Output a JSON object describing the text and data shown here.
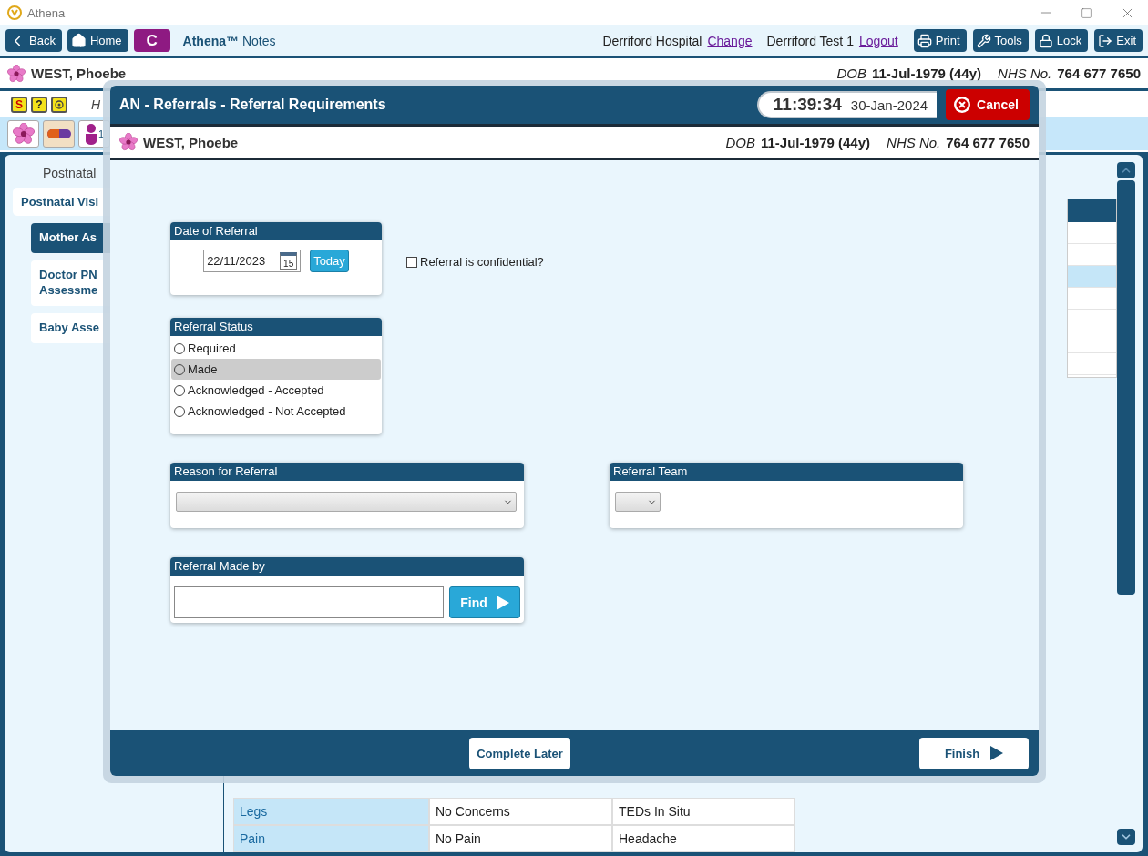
{
  "window": {
    "title": "Athena"
  },
  "toolbar": {
    "nav_buttons": [
      {
        "label": "Back",
        "kind": "back"
      },
      {
        "label": "Home",
        "kind": "home"
      }
    ],
    "badge": "C",
    "app_name": "Athena™",
    "app_subtitle": "Notes",
    "hospital": "Derriford Hospital",
    "change_link": "Change",
    "user": "Derriford Test 1",
    "logout_link": "Logout",
    "actions": [
      {
        "label": "Print",
        "kind": "print"
      },
      {
        "label": "Tools",
        "kind": "tools"
      },
      {
        "label": "Lock",
        "kind": "lock"
      },
      {
        "label": "Exit",
        "kind": "exit"
      }
    ]
  },
  "patient": {
    "name": "WEST, Phoebe",
    "dob_label": "DOB",
    "dob": "11-Jul-1979 (44y)",
    "nhs_label": "NHS No.",
    "nhs": "764 677 7650"
  },
  "alert_bar": {
    "icons": [
      {
        "kind": "hand",
        "symbol": "S"
      },
      {
        "kind": "help",
        "symbol": "?"
      },
      {
        "kind": "target"
      }
    ],
    "text": "H"
  },
  "quick_icons": [
    {
      "kind": "flower"
    },
    {
      "kind": "pill"
    },
    {
      "kind": "person",
      "count": "1"
    }
  ],
  "nav": {
    "heading": "Postnatal",
    "items": [
      {
        "label": "Postnatal Visi",
        "selected": false,
        "children": [
          {
            "label": "Mother As",
            "selected": true
          },
          {
            "label": "Doctor PN Assessme",
            "selected": false
          },
          {
            "label": "Baby Asse",
            "selected": false
          }
        ]
      }
    ]
  },
  "background_table": {
    "rows": [
      {
        "cells": [
          "Legs",
          "No Concerns",
          "TEDs In Situ"
        ]
      },
      {
        "cells": [
          "Pain",
          "No Pain",
          "Headache"
        ]
      }
    ]
  },
  "dialog": {
    "title": "AN - Referrals - Referral Requirements",
    "time": "11:39:34",
    "date": "30-Jan-2024",
    "cancel": "Cancel",
    "patient": {
      "name": "WEST, Phoebe",
      "dob_label": "DOB",
      "dob": "11-Jul-1979 (44y)",
      "nhs_label": "NHS No.",
      "nhs": "764 677 7650"
    },
    "date_of_referral": {
      "heading": "Date of Referral",
      "value": "22/11/2023",
      "calendar_day": "15",
      "today": "Today"
    },
    "confidential": {
      "label": "Referral is confidential?",
      "checked": false
    },
    "status": {
      "heading": "Referral Status",
      "options": [
        {
          "label": "Required",
          "selected": false,
          "highlighted": false
        },
        {
          "label": "Made",
          "selected": false,
          "highlighted": true
        },
        {
          "label": "Acknowledged - Accepted",
          "selected": false,
          "highlighted": false
        },
        {
          "label": "Acknowledged - Not Accepted",
          "selected": false,
          "highlighted": false
        }
      ]
    },
    "reason": {
      "heading": "Reason for Referral"
    },
    "team": {
      "heading": "Referral Team"
    },
    "made_by": {
      "heading": "Referral Made by",
      "find": "Find"
    },
    "footer": {
      "complete_later": "Complete Later",
      "finish": "Finish"
    }
  }
}
